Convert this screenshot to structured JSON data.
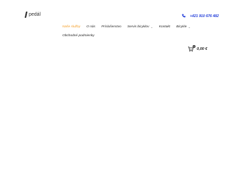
{
  "brand": {
    "name": "pedál"
  },
  "header": {
    "phone": "+421 910 676 482"
  },
  "nav": {
    "items": [
      {
        "label": "Naše služby",
        "active": true
      },
      {
        "label": "O nás"
      },
      {
        "label": "Príslušenstvo"
      },
      {
        "label": "Servis bicyklov",
        "has_dropdown": true
      },
      {
        "label": "Kontakt"
      },
      {
        "label": "Bicykle",
        "has_dropdown": true
      },
      {
        "label": "Obchodné podmienky"
      }
    ]
  },
  "cart": {
    "total": "0,00 €",
    "count": "0"
  },
  "colors": {
    "accent": "#f39a1e",
    "phone": "#1f3bd9"
  },
  "icons": {
    "phone": "phone-icon",
    "cart": "cart-icon",
    "dropdown": "chevron-down-icon"
  }
}
